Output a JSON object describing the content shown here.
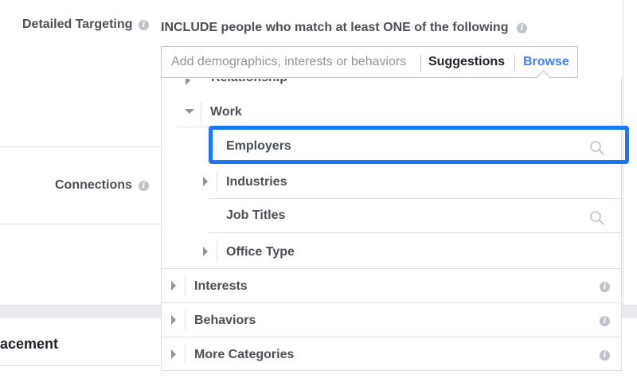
{
  "form": {
    "detailed_targeting_label": "Detailed Targeting",
    "include_text": "INCLUDE people who match at least ONE of the following",
    "connections_label": "Connections",
    "placement_label_partial": "acement"
  },
  "search": {
    "placeholder": "Add demographics, interests or behaviors",
    "suggestions_label": "Suggestions",
    "browse_label": "Browse"
  },
  "tree": {
    "partial_top": "Relationship",
    "work": "Work",
    "work_children": {
      "employers": "Employers",
      "industries": "Industries",
      "job_titles": "Job Titles",
      "office_type": "Office Type"
    },
    "interests": "Interests",
    "behaviors": "Behaviors",
    "more_categories": "More Categories"
  },
  "colors": {
    "link": "#4080ff",
    "highlight": "#1877f2",
    "text": "#4b4f56",
    "muted": "#90949c"
  }
}
